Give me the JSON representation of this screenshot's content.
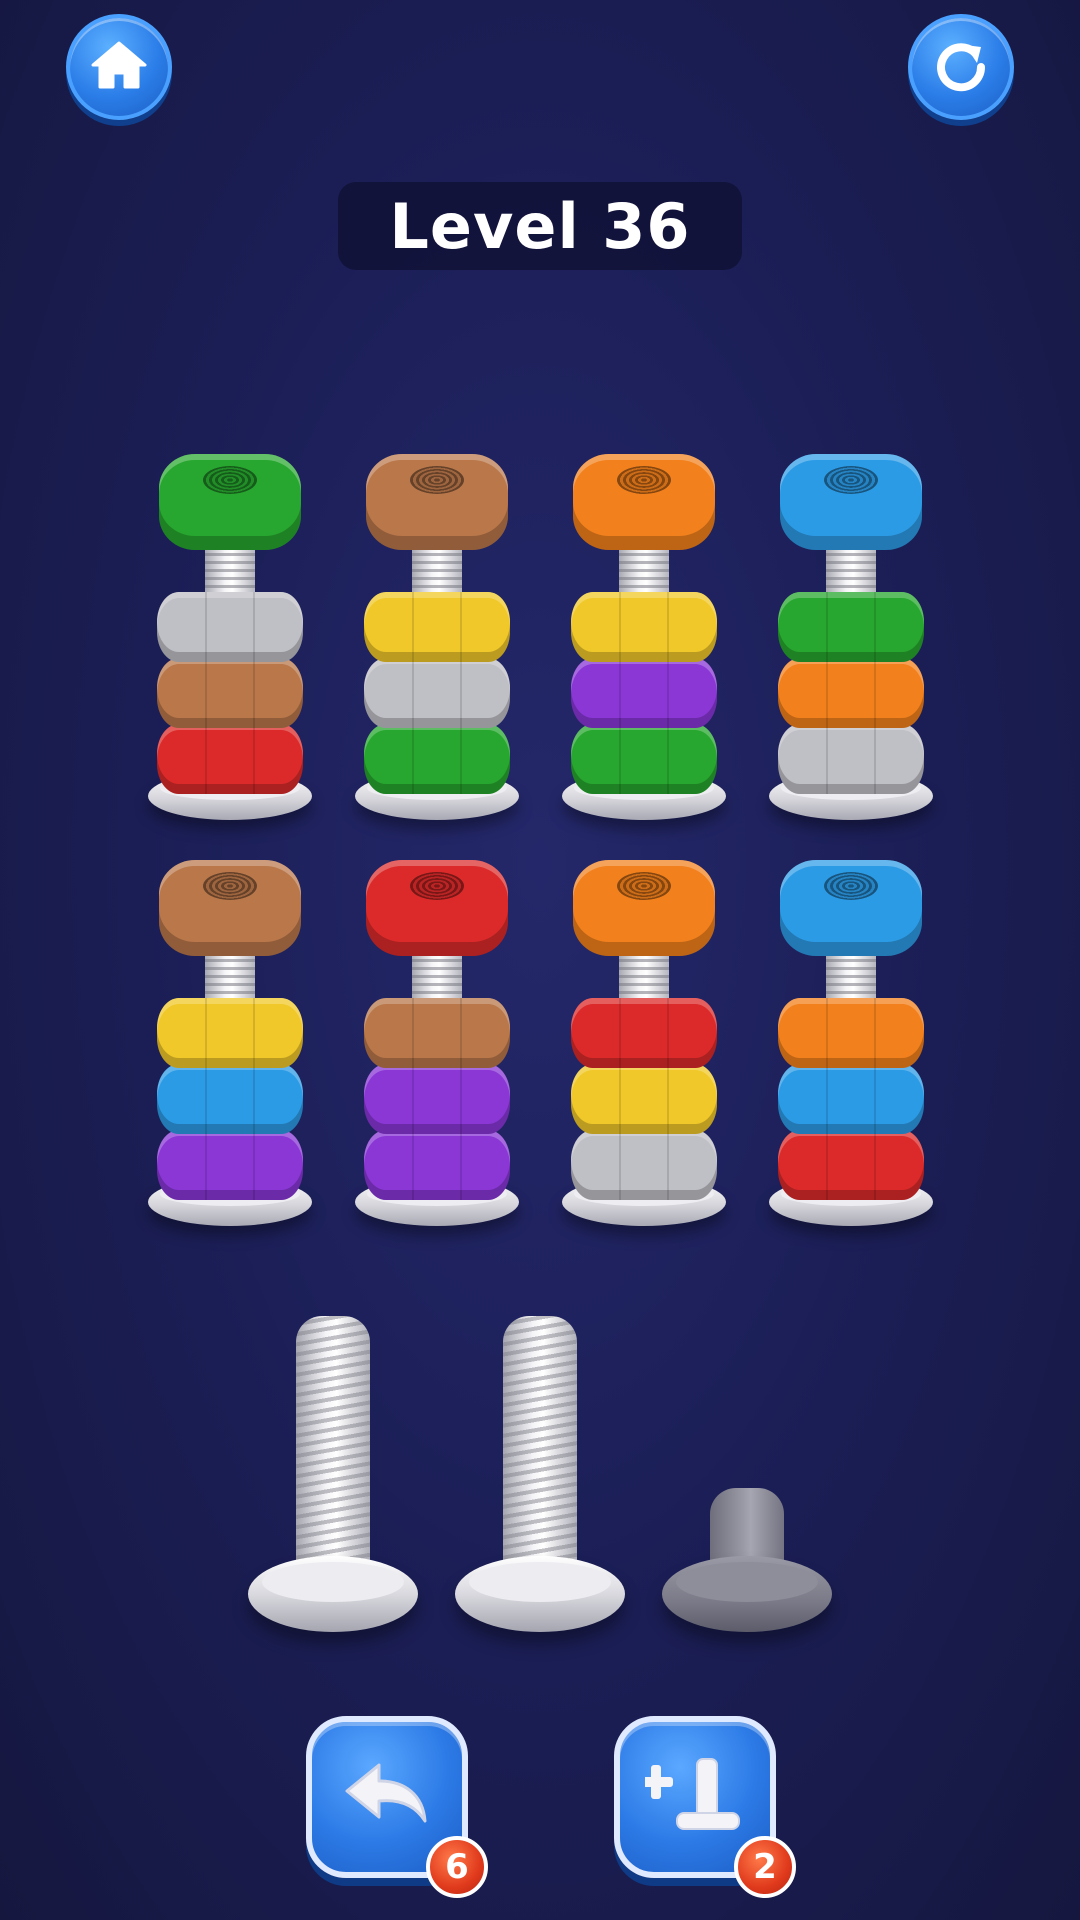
{
  "header": {
    "level_title": "Level 36",
    "home_icon": "home-icon",
    "restart_icon": "restart-icon"
  },
  "colors": {
    "green": "#27a72f",
    "bronze": "#b9774a",
    "orange": "#f2801c",
    "blue": "#2c9be6",
    "gray": "#bfbfc6",
    "yellow": "#f0c82a",
    "red": "#dc2a2a",
    "purple": "#8a37d6",
    "button_blue": "#2c7ae6",
    "badge_red": "#e03a1c"
  },
  "board": {
    "columns": [
      {
        "nuts_bottom_to_top": [
          "red",
          "bronze",
          "gray"
        ],
        "top_nut": "green"
      },
      {
        "nuts_bottom_to_top": [
          "green",
          "gray",
          "yellow"
        ],
        "top_nut": "bronze"
      },
      {
        "nuts_bottom_to_top": [
          "green",
          "purple",
          "yellow"
        ],
        "top_nut": "orange"
      },
      {
        "nuts_bottom_to_top": [
          "gray",
          "orange",
          "green"
        ],
        "top_nut": "blue"
      },
      {
        "nuts_bottom_to_top": [
          "purple",
          "blue",
          "yellow"
        ],
        "top_nut": "bronze"
      },
      {
        "nuts_bottom_to_top": [
          "purple",
          "purple",
          "bronze"
        ],
        "top_nut": "red"
      },
      {
        "nuts_bottom_to_top": [
          "gray",
          "yellow",
          "red"
        ],
        "top_nut": "orange"
      },
      {
        "nuts_bottom_to_top": [
          "red",
          "blue",
          "orange"
        ],
        "top_nut": "blue"
      }
    ]
  },
  "extra_bolts": [
    {
      "state": "empty"
    },
    {
      "state": "empty"
    },
    {
      "state": "locked"
    }
  ],
  "actions": {
    "undo_icon": "undo-arrow-icon",
    "undo_count": "6",
    "add_bolt_icon": "add-bolt-icon",
    "add_bolt_count": "2"
  }
}
